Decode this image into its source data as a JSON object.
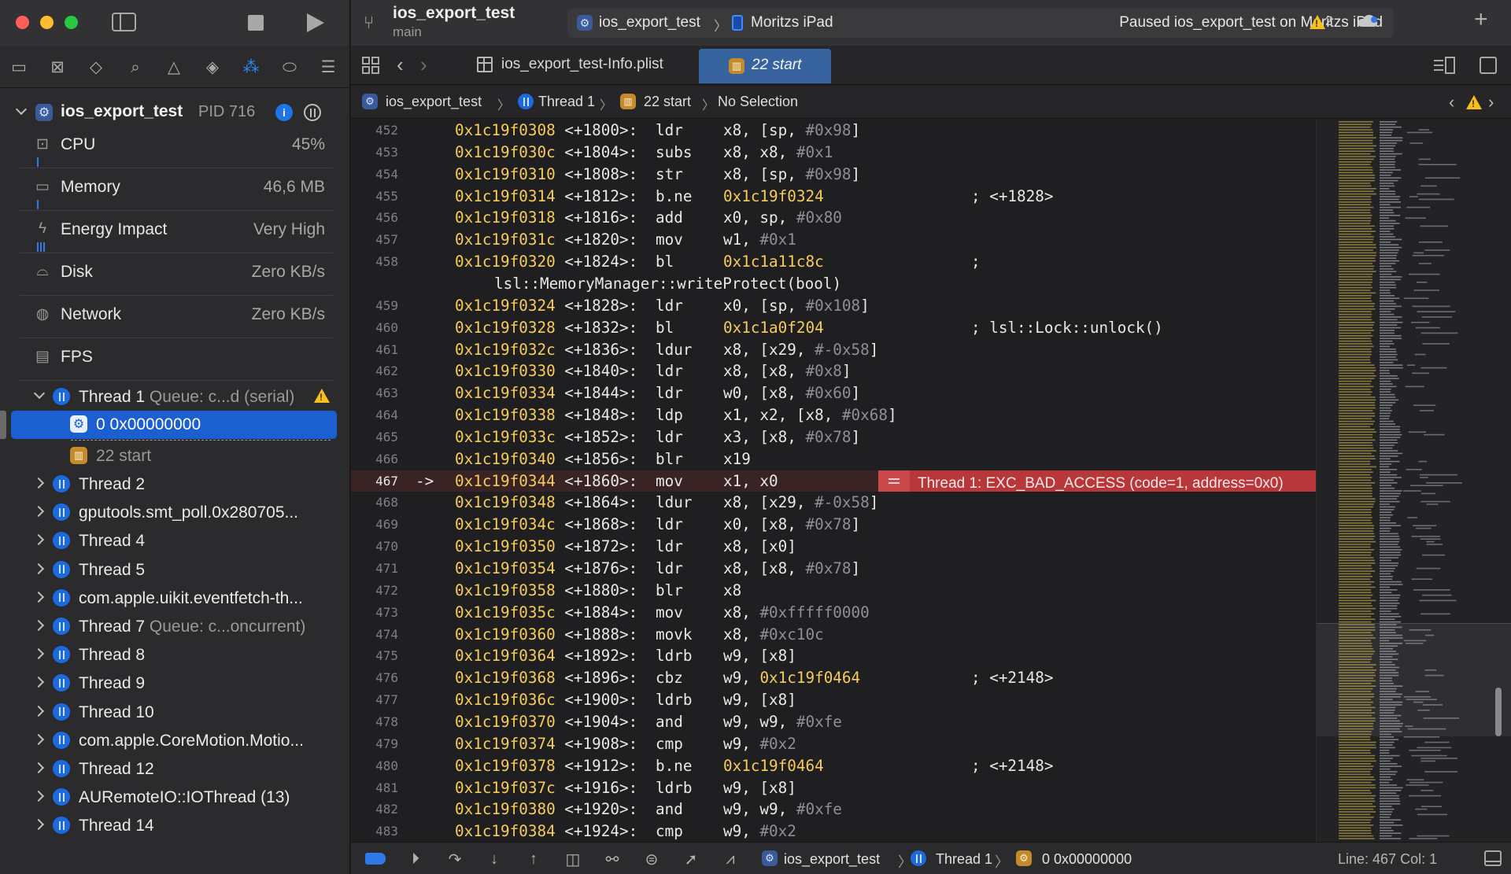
{
  "colors": {
    "accent": "#1b5fd0",
    "warning": "#f5c01c",
    "error_ribbon": "#b7373a",
    "address": "#f7cd55"
  },
  "titlebar": {
    "project": "ios_export_test",
    "branch": "main",
    "scheme": "ios_export_test",
    "device": "Moritzs iPad",
    "status": "Paused ios_export_test on Moritzs iPad",
    "warning_count": "2"
  },
  "navigator": {
    "process": {
      "name": "ios_export_test",
      "pid": "PID 716"
    },
    "gauges": [
      {
        "label": "CPU",
        "value": "45%",
        "icon": "cpu-icon"
      },
      {
        "label": "Memory",
        "value": "46,6 MB",
        "icon": "memory-icon"
      },
      {
        "label": "Energy Impact",
        "value": "Very High",
        "icon": "bolt-icon"
      },
      {
        "label": "Disk",
        "value": "Zero KB/s",
        "icon": "disk-icon"
      },
      {
        "label": "Network",
        "value": "Zero KB/s",
        "icon": "globe-icon"
      },
      {
        "label": "FPS",
        "value": "",
        "icon": "film-icon"
      }
    ],
    "thread1": {
      "label": "Thread 1",
      "queue": "Queue: c...d (serial)"
    },
    "frames": [
      {
        "label": "0 0x00000000"
      },
      {
        "label": "22 start"
      }
    ],
    "threads": [
      {
        "label": "Thread 2",
        "queue": ""
      },
      {
        "label": "gputools.smt_poll.0x280705...",
        "queue": ""
      },
      {
        "label": "Thread 4",
        "queue": ""
      },
      {
        "label": "Thread 5",
        "queue": ""
      },
      {
        "label": "com.apple.uikit.eventfetch-th...",
        "queue": ""
      },
      {
        "label": "Thread 7",
        "queue": "Queue: c...oncurrent)"
      },
      {
        "label": "Thread 8",
        "queue": ""
      },
      {
        "label": "Thread 9",
        "queue": ""
      },
      {
        "label": "Thread 10",
        "queue": ""
      },
      {
        "label": "com.apple.CoreMotion.Motio...",
        "queue": ""
      },
      {
        "label": "Thread 12",
        "queue": ""
      },
      {
        "label": "AURemoteIO::IOThread (13)",
        "queue": ""
      },
      {
        "label": "Thread 14",
        "queue": ""
      }
    ]
  },
  "tabs": {
    "plist": "ios_export_test-Info.plist",
    "active": "22 start"
  },
  "jumpbar": {
    "project": "ios_export_test",
    "thread": "Thread 1",
    "frame": "22 start",
    "selection": "No Selection"
  },
  "code": {
    "current_arrow": "->",
    "error_message": "Thread 1: EXC_BAD_ACCESS (code=1, address=0x0)",
    "lines": [
      {
        "n": "452",
        "addr": "0x1c19f0308",
        "off": " <+1800>:",
        "mn": "ldr",
        "ops": "x8, [sp, ",
        "imm": "#0x98",
        "tail": "]",
        "cmt": ""
      },
      {
        "n": "453",
        "addr": "0x1c19f030c",
        "off": " <+1804>:",
        "mn": "subs",
        "ops": "x8, x8, ",
        "imm": "#0x1",
        "tail": "",
        "cmt": ""
      },
      {
        "n": "454",
        "addr": "0x1c19f0310",
        "off": " <+1808>:",
        "mn": "str",
        "ops": "x8, [sp, ",
        "imm": "#0x98",
        "tail": "]",
        "cmt": ""
      },
      {
        "n": "455",
        "addr": "0x1c19f0314",
        "off": " <+1812>:",
        "mn": "b.ne",
        "target": "0x1c19f0324",
        "cmt": "; <+1828>"
      },
      {
        "n": "456",
        "addr": "0x1c19f0318",
        "off": " <+1816>:",
        "mn": "add",
        "ops": "x0, sp, ",
        "imm": "#0x80",
        "tail": "",
        "cmt": ""
      },
      {
        "n": "457",
        "addr": "0x1c19f031c",
        "off": " <+1820>:",
        "mn": "mov",
        "ops": "w1, ",
        "imm": "#0x1",
        "tail": "",
        "cmt": ""
      },
      {
        "n": "458",
        "addr": "0x1c19f0320",
        "off": " <+1824>:",
        "mn": "bl",
        "target": "0x1c1a11c8c",
        "cmt": ";"
      },
      {
        "wrap": "lsl::MemoryManager::writeProtect(bool)"
      },
      {
        "n": "459",
        "addr": "0x1c19f0324",
        "off": " <+1828>:",
        "mn": "ldr",
        "ops": "x0, [sp, ",
        "imm": "#0x108",
        "tail": "]",
        "cmt": ""
      },
      {
        "n": "460",
        "addr": "0x1c19f0328",
        "off": " <+1832>:",
        "mn": "bl",
        "target": "0x1c1a0f204",
        "cmt": "; lsl::Lock::unlock()"
      },
      {
        "n": "461",
        "addr": "0x1c19f032c",
        "off": " <+1836>:",
        "mn": "ldur",
        "ops": "x8, [x29, ",
        "imm": "#-0x58",
        "tail": "]",
        "cmt": ""
      },
      {
        "n": "462",
        "addr": "0x1c19f0330",
        "off": " <+1840>:",
        "mn": "ldr",
        "ops": "x8, [x8, ",
        "imm": "#0x8",
        "tail": "]",
        "cmt": ""
      },
      {
        "n": "463",
        "addr": "0x1c19f0334",
        "off": " <+1844>:",
        "mn": "ldr",
        "ops": "w0, [x8, ",
        "imm": "#0x60",
        "tail": "]",
        "cmt": ""
      },
      {
        "n": "464",
        "addr": "0x1c19f0338",
        "off": " <+1848>:",
        "mn": "ldp",
        "ops": "x1, x2, [x8, ",
        "imm": "#0x68",
        "tail": "]",
        "cmt": ""
      },
      {
        "n": "465",
        "addr": "0x1c19f033c",
        "off": " <+1852>:",
        "mn": "ldr",
        "ops": "x3, [x8, ",
        "imm": "#0x78",
        "tail": "]",
        "cmt": ""
      },
      {
        "n": "466",
        "addr": "0x1c19f0340",
        "off": " <+1856>:",
        "mn": "blr",
        "ops": "x19",
        "imm": "",
        "tail": "",
        "cmt": ""
      },
      {
        "n": "467",
        "addr": "0x1c19f0344",
        "off": " <+1860>:",
        "mn": "mov",
        "ops": "x1, x0",
        "imm": "",
        "tail": "",
        "cmt": "",
        "current": true
      },
      {
        "n": "468",
        "addr": "0x1c19f0348",
        "off": " <+1864>:",
        "mn": "ldur",
        "ops": "x8, [x29, ",
        "imm": "#-0x58",
        "tail": "]",
        "cmt": ""
      },
      {
        "n": "469",
        "addr": "0x1c19f034c",
        "off": " <+1868>:",
        "mn": "ldr",
        "ops": "x0, [x8, ",
        "imm": "#0x78",
        "tail": "]",
        "cmt": ""
      },
      {
        "n": "470",
        "addr": "0x1c19f0350",
        "off": " <+1872>:",
        "mn": "ldr",
        "ops": "x8, [x0]",
        "imm": "",
        "tail": "",
        "cmt": ""
      },
      {
        "n": "471",
        "addr": "0x1c19f0354",
        "off": " <+1876>:",
        "mn": "ldr",
        "ops": "x8, [x8, ",
        "imm": "#0x78",
        "tail": "]",
        "cmt": ""
      },
      {
        "n": "472",
        "addr": "0x1c19f0358",
        "off": " <+1880>:",
        "mn": "blr",
        "ops": "x8",
        "imm": "",
        "tail": "",
        "cmt": ""
      },
      {
        "n": "473",
        "addr": "0x1c19f035c",
        "off": " <+1884>:",
        "mn": "mov",
        "ops": "x8, ",
        "imm": "#0xfffff0000",
        "tail": "",
        "cmt": ""
      },
      {
        "n": "474",
        "addr": "0x1c19f0360",
        "off": " <+1888>:",
        "mn": "movk",
        "ops": "x8, ",
        "imm": "#0xc10c",
        "tail": "",
        "cmt": ""
      },
      {
        "n": "475",
        "addr": "0x1c19f0364",
        "off": " <+1892>:",
        "mn": "ldrb",
        "ops": "w9, [x8]",
        "imm": "",
        "tail": "",
        "cmt": ""
      },
      {
        "n": "476",
        "addr": "0x1c19f0368",
        "off": " <+1896>:",
        "mn": "cbz",
        "ops": "w9, ",
        "target2": "0x1c19f0464",
        "cmt": "; <+2148>"
      },
      {
        "n": "477",
        "addr": "0x1c19f036c",
        "off": " <+1900>:",
        "mn": "ldrb",
        "ops": "w9, [x8]",
        "imm": "",
        "tail": "",
        "cmt": ""
      },
      {
        "n": "478",
        "addr": "0x1c19f0370",
        "off": " <+1904>:",
        "mn": "and",
        "ops": "w9, w9, ",
        "imm": "#0xfe",
        "tail": "",
        "cmt": ""
      },
      {
        "n": "479",
        "addr": "0x1c19f0374",
        "off": " <+1908>:",
        "mn": "cmp",
        "ops": "w9, ",
        "imm": "#0x2",
        "tail": "",
        "cmt": ""
      },
      {
        "n": "480",
        "addr": "0x1c19f0378",
        "off": " <+1912>:",
        "mn": "b.ne",
        "target": "0x1c19f0464",
        "cmt": "; <+2148>"
      },
      {
        "n": "481",
        "addr": "0x1c19f037c",
        "off": " <+1916>:",
        "mn": "ldrb",
        "ops": "w9, [x8]",
        "imm": "",
        "tail": "",
        "cmt": ""
      },
      {
        "n": "482",
        "addr": "0x1c19f0380",
        "off": " <+1920>:",
        "mn": "and",
        "ops": "w9, w9, ",
        "imm": "#0xfe",
        "tail": "",
        "cmt": ""
      },
      {
        "n": "483",
        "addr": "0x1c19f0384",
        "off": " <+1924>:",
        "mn": "cmp",
        "ops": "w9, ",
        "imm": "#0x2",
        "tail": "",
        "cmt": ""
      }
    ]
  },
  "debugbar": {
    "project": "ios_export_test",
    "thread": "Thread 1",
    "frame": "0 0x00000000",
    "position": "Line: 467  Col: 1"
  }
}
